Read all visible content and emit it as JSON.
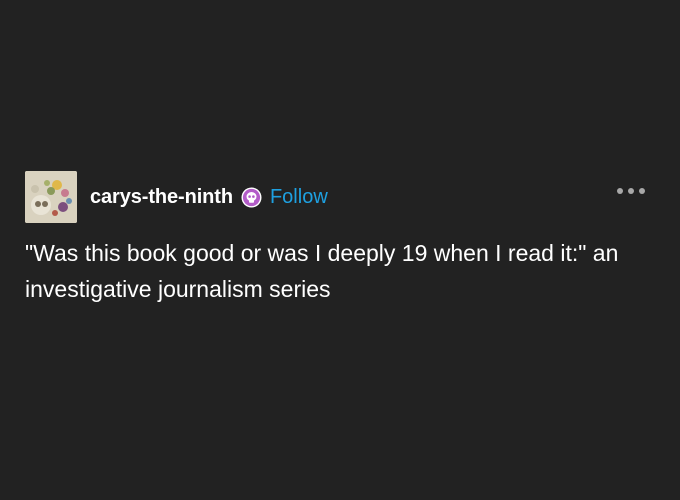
{
  "post": {
    "username": "carys-the-ninth",
    "badge_icon": "skull-icon",
    "follow_label": "Follow",
    "more_icon": "ellipsis-icon",
    "body_text": "\"Was this book good or was I deeply 19 when I read it:\" an investigative journalism series"
  },
  "colors": {
    "background": "#222222",
    "text": "#ffffff",
    "follow": "#1ea0e0",
    "badge": "#b35cc8"
  }
}
